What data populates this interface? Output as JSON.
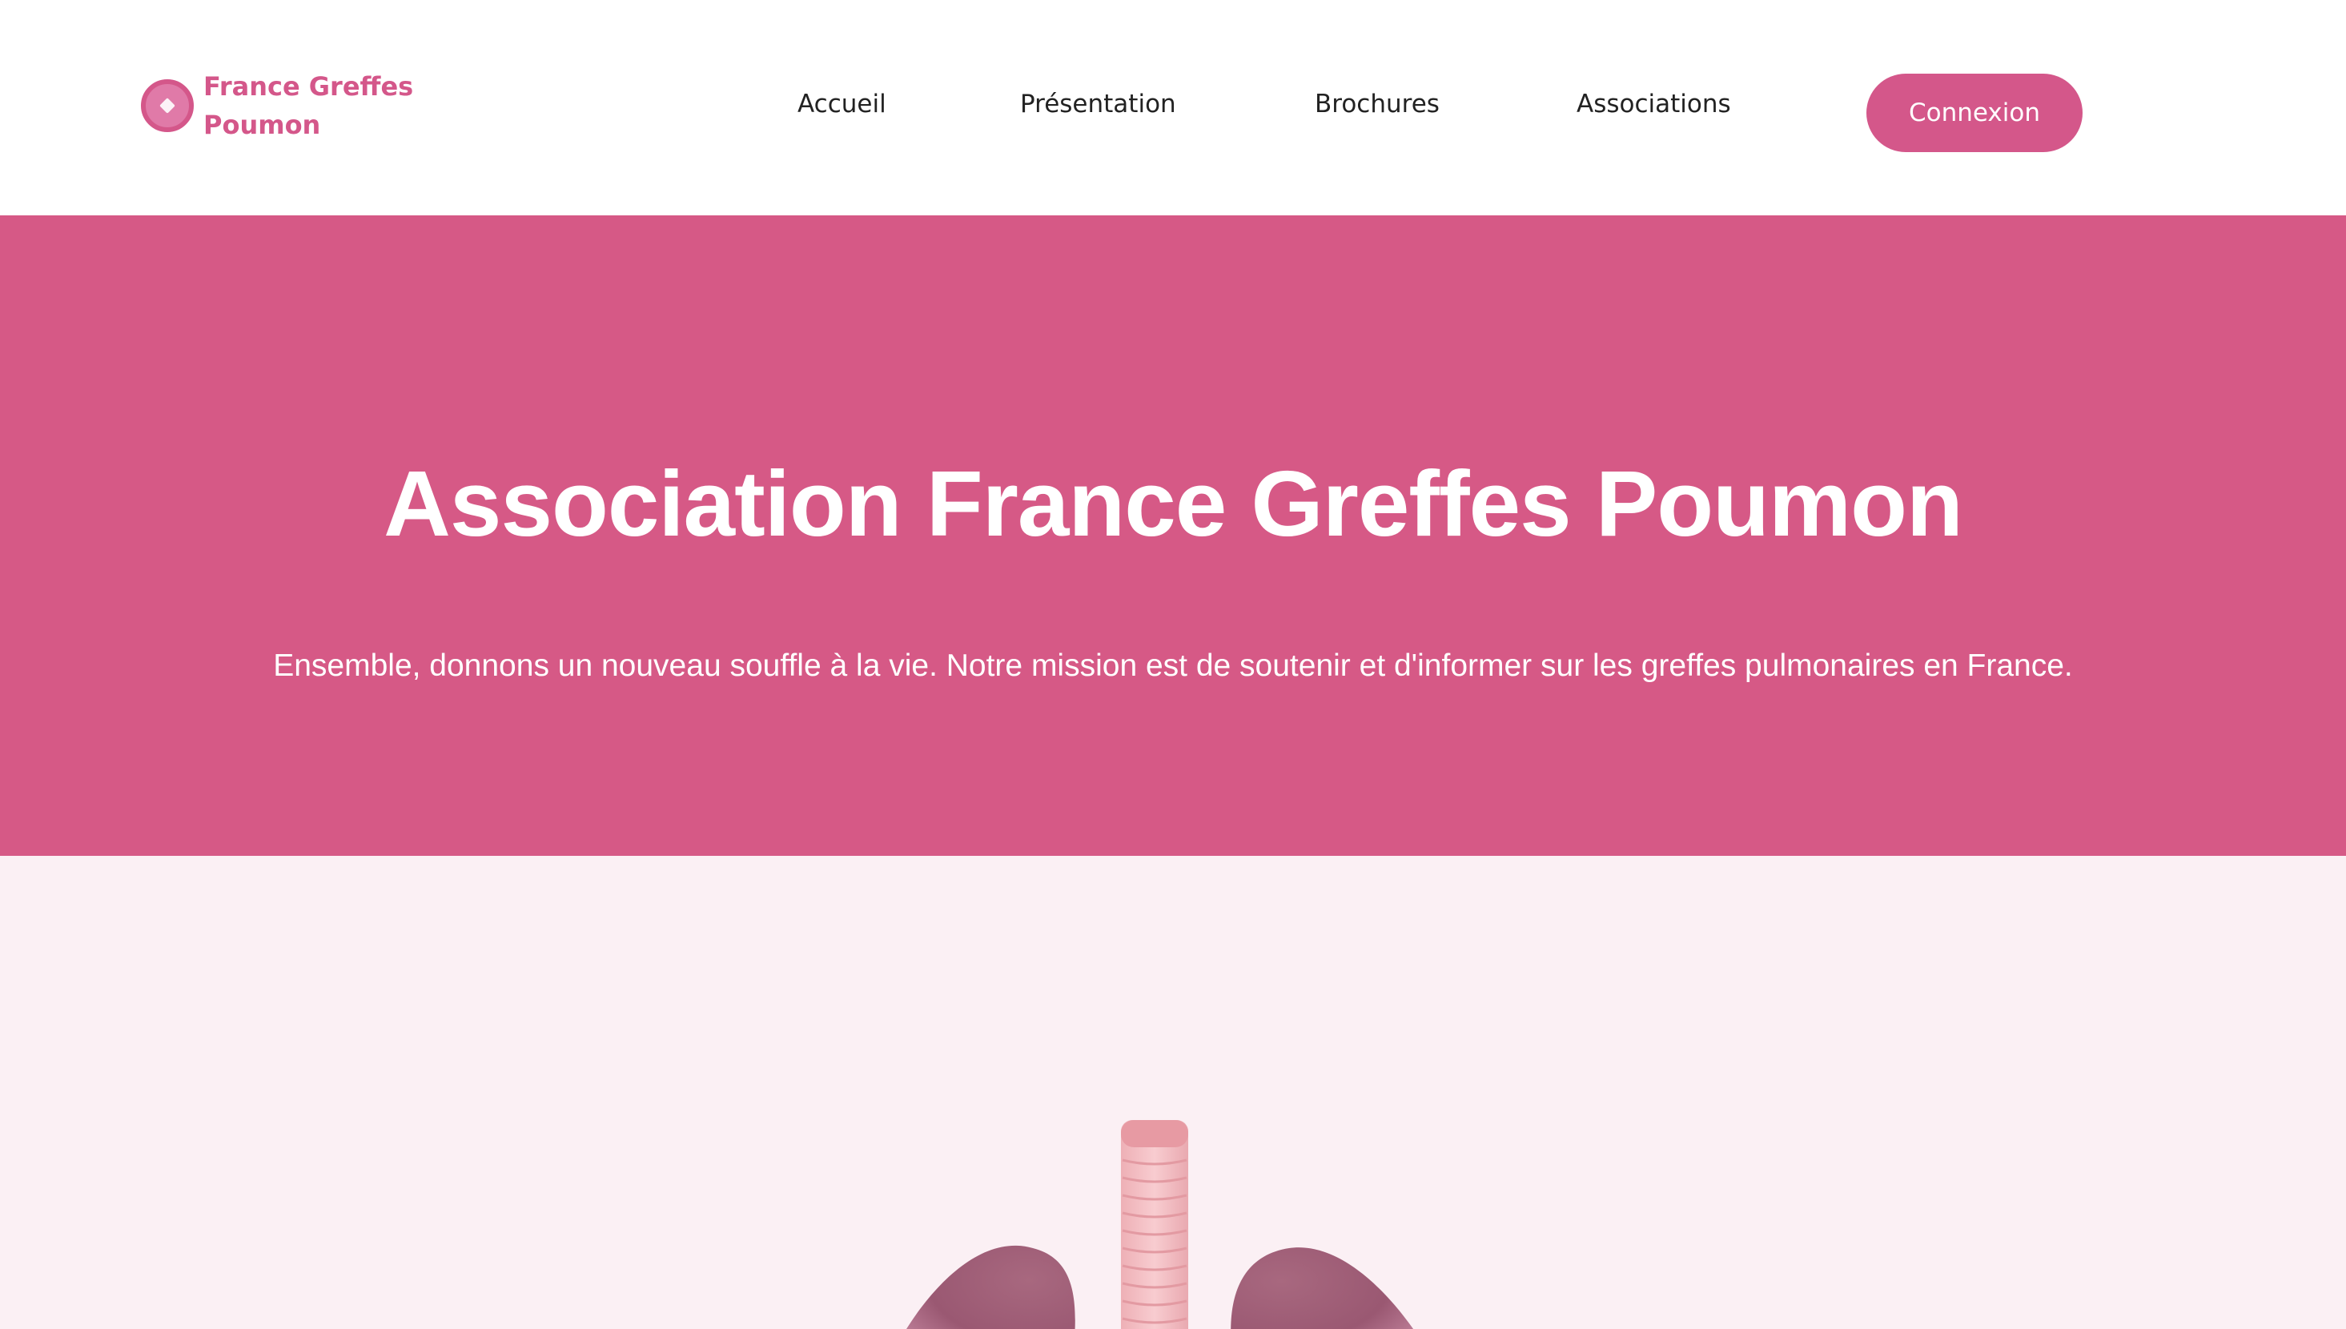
{
  "header": {
    "logo_text": "France Greffes Poumon",
    "logo_icon": "lung-logo-icon",
    "nav": {
      "accueil": "Accueil",
      "presentation": "Présentation",
      "brochures": "Brochures",
      "associations": "Associations"
    },
    "login_button": "Connexion"
  },
  "hero": {
    "title": "Association France Greffes Poumon",
    "subtitle": "Ensemble, donnons un nouveau souffle à la vie. Notre mission est de soutenir et d'informer sur les greffes pulmonaires en France.",
    "carousel": {
      "count": 4,
      "active_index": 0
    }
  },
  "colors": {
    "brand": "#d4578a",
    "hero_bg": "#d65986",
    "section_bg": "#fbf0f4",
    "nav_text": "#222222",
    "dot_active": "#ec97c6",
    "dot_inactive": "#f0d3df"
  }
}
